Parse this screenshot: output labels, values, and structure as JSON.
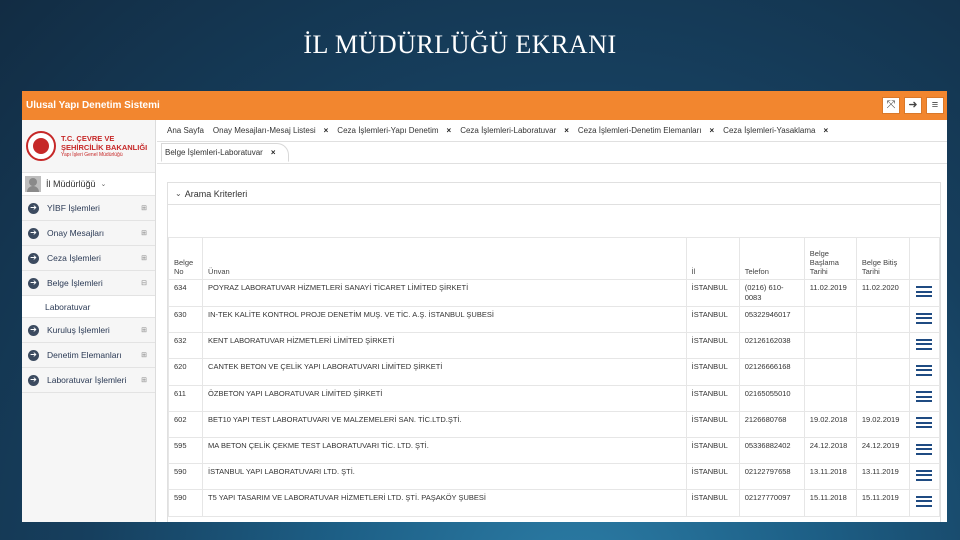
{
  "slide_title": "İL MÜDÜRLÜĞÜ EKRANI",
  "app": {
    "name": "Ulusal Yapı Denetim Sistemi",
    "toolbar_icons": [
      "fullscreen-icon",
      "logout-icon",
      "menu-icon"
    ]
  },
  "logo": {
    "line1": "T.C. ÇEVRE VE",
    "line2": "ŞEHİRCİLİK BAKANLIĞI",
    "line3": "Yapı İşleri Genel Müdürlüğü"
  },
  "user": {
    "name": "İl Müdürlüğü"
  },
  "sidebar": {
    "items": [
      {
        "label": "YİBF İşlemleri"
      },
      {
        "label": "Onay Mesajları"
      },
      {
        "label": "Ceza İşlemleri"
      },
      {
        "label": "Belge İşlemleri",
        "sub": "Laboratuvar"
      },
      {
        "label": "Kuruluş İşlemleri"
      },
      {
        "label": "Denetim Elemanları"
      },
      {
        "label": "Laboratuvar İşlemleri"
      }
    ]
  },
  "tabs": {
    "row1": [
      {
        "label": "Ana Sayfa"
      },
      {
        "label": "Onay Mesajları-Mesaj Listesi"
      },
      {
        "label": "Ceza İşlemleri-Yapı Denetim"
      },
      {
        "label": "Ceza İşlemleri-Laboratuvar"
      },
      {
        "label": "Ceza İşlemleri-Denetim Elemanları"
      },
      {
        "label": "Ceza İşlemleri-Yasaklama"
      }
    ],
    "active": "Belge İşlemleri-Laboratuvar",
    "close_symbol": "×"
  },
  "panel": {
    "title": "Arama Kriterleri"
  },
  "table": {
    "headers": [
      "Belge No",
      "Ünvan",
      "İl",
      "Telefon",
      "Belge Başlama Tarihi",
      "Belge Bitiş Tarihi",
      ""
    ],
    "rows": [
      [
        "634",
        "POYRAZ LABORATUVAR HİZMETLERİ SANAYİ TİCARET LİMİTED ŞİRKETİ",
        "İSTANBUL",
        "(0216) 610-0083",
        "11.02.2019",
        "11.02.2020"
      ],
      [
        "630",
        "IN-TEK KALİTE KONTROL PROJE DENETİM MUŞ. VE TİC. A.Ş. İSTANBUL ŞUBESİ",
        "İSTANBUL",
        "05322946017",
        "",
        ""
      ],
      [
        "632",
        "KENT LABORATUVAR HİZMETLERİ LİMİTED ŞİRKETİ",
        "İSTANBUL",
        "02126162038",
        "",
        ""
      ],
      [
        "620",
        "CANTEK BETON VE ÇELİK YAPI LABORATUVARI LİMİTED ŞİRKETİ",
        "İSTANBUL",
        "02126666168",
        "",
        ""
      ],
      [
        "611",
        "ÖZBETON YAPI LABORATUVAR LİMİTED ŞİRKETİ",
        "İSTANBUL",
        "02165055010",
        "",
        ""
      ],
      [
        "602",
        "BET10 YAPI TEST LABORATUVARI VE MALZEMELERİ SAN. TİC.LTD.ŞTİ.",
        "İSTANBUL",
        "2126680768",
        "19.02.2018",
        "19.02.2019"
      ],
      [
        "595",
        "MA BETON ÇELİK ÇEKME TEST LABORATUVARI TİC. LTD. ŞTİ.",
        "İSTANBUL",
        "05336882402",
        "24.12.2018",
        "24.12.2019"
      ],
      [
        "590",
        "İSTANBUL YAPI LABORATUVARI LTD. ŞTİ.",
        "İSTANBUL",
        "02122797658",
        "13.11.2018",
        "13.11.2019"
      ],
      [
        "590",
        "T5 YAPI TASARIM VE LABORATUVAR HİZMETLERİ LTD. ŞTİ. PAŞAKÖY ŞUBESİ",
        "İSTANBUL",
        "02127770097",
        "15.11.2018",
        "15.11.2019"
      ]
    ]
  },
  "colors": {
    "topbar": "#f2862f",
    "menu_icon": "#3c4b60",
    "list_icon": "#1f4b82",
    "logo_red": "#c62828"
  }
}
